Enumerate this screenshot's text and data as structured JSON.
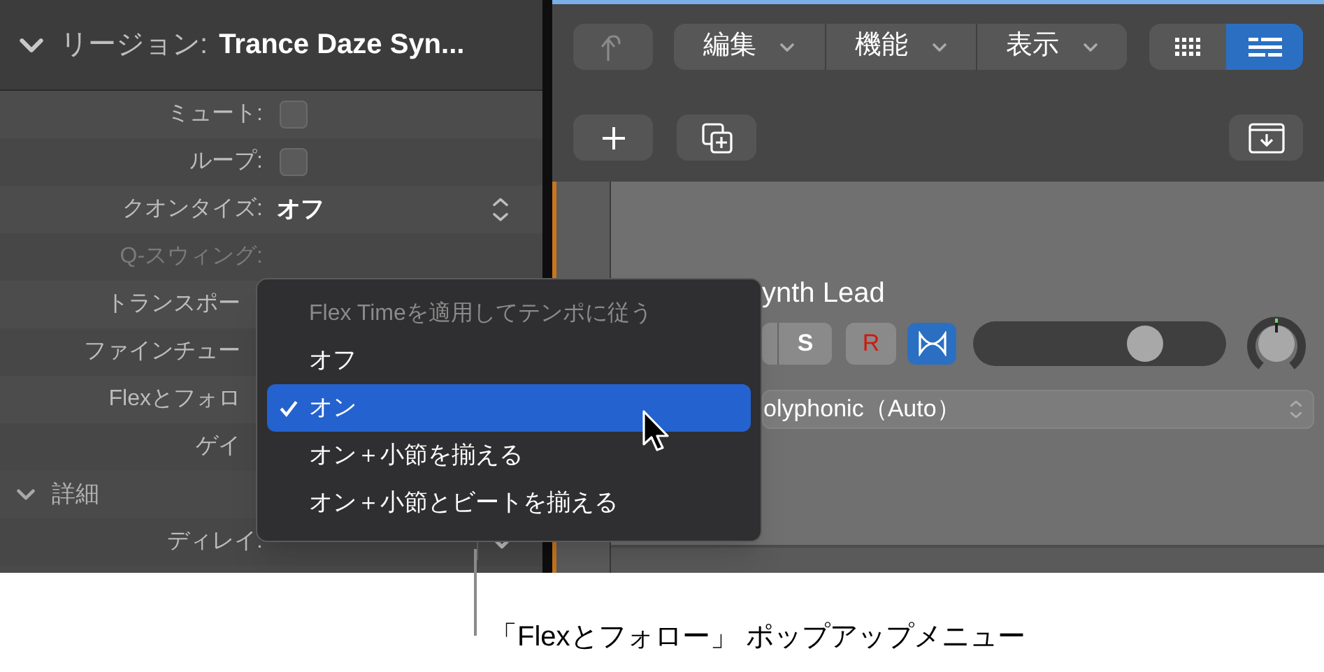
{
  "inspector": {
    "header": {
      "expanded": true,
      "label": "リージョン:",
      "value": "Trance Daze Syn..."
    },
    "rows": [
      {
        "kind": "checkbox",
        "label": "ミュート:",
        "checked": false,
        "disabled": false
      },
      {
        "kind": "checkbox",
        "label": "ループ:",
        "checked": false,
        "disabled": false
      },
      {
        "kind": "popup",
        "label": "クオンタイズ:",
        "value": "オフ",
        "disabled": false
      },
      {
        "kind": "label",
        "label": "Q-スウィング:",
        "disabled": true
      },
      {
        "kind": "covered",
        "label": "トランスポー",
        "disabled": false
      },
      {
        "kind": "covered",
        "label": "ファインチュー",
        "disabled": false
      },
      {
        "kind": "covered",
        "label": "Flexとフォロ",
        "disabled": false
      },
      {
        "kind": "covered",
        "label": "ゲイ",
        "disabled": false
      }
    ],
    "section": {
      "label": "詳細",
      "expanded": true
    },
    "detail_rows": [
      {
        "kind": "stepper",
        "label": "ディレイ:",
        "disabled": false
      }
    ]
  },
  "popup_menu": {
    "items": [
      {
        "kind": "header",
        "label": "Flex Timeを適用してテンポに従う"
      },
      {
        "kind": "option",
        "label": "オフ",
        "selected": false
      },
      {
        "kind": "option",
        "label": "オン",
        "selected": true
      },
      {
        "kind": "option",
        "label": "オン＋小節を揃える",
        "selected": false
      },
      {
        "kind": "option",
        "label": "オン＋小節とビートを揃える",
        "selected": false
      }
    ]
  },
  "toolbar": {
    "back_disabled": true,
    "menus": [
      {
        "label": "編集"
      },
      {
        "label": "機能"
      },
      {
        "label": "表示"
      }
    ],
    "views": [
      {
        "kind": "grid",
        "selected": false
      },
      {
        "kind": "list",
        "selected": true
      }
    ]
  },
  "track": {
    "name": "ynth Lead",
    "buttons": [
      {
        "kind": "solo",
        "label": "S"
      },
      {
        "kind": "record",
        "label": "R"
      }
    ],
    "flex_on": true,
    "volume": {
      "level": 0.72
    },
    "mode": "olyphonic（Auto）"
  },
  "callout": {
    "text": "「Flexとフォロー」 ポップアップメニュー"
  }
}
